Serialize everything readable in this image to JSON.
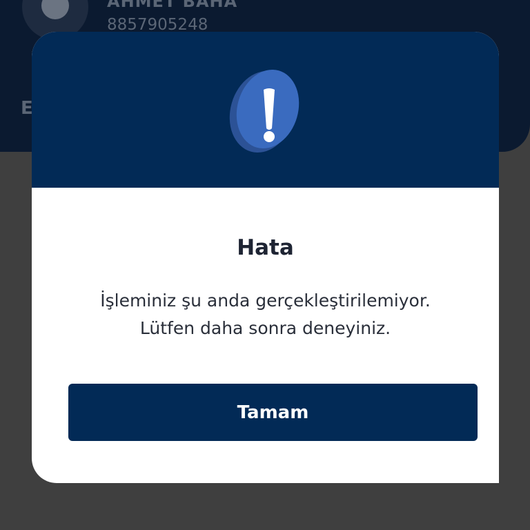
{
  "background": {
    "user_name": "AHMET BAHA",
    "phone": "8857905248",
    "section_letter": "E"
  },
  "dialog": {
    "icon": "exclamation-icon",
    "title": "Hata",
    "message_line1": "İşleminiz şu anda gerçekleştirilemiyor.",
    "message_line2": "Lütfen daha sonra deneyiniz.",
    "button_label": "Tamam"
  },
  "colors": {
    "dialog_header": "#022a56",
    "button": "#022a56",
    "icon_blue": "#3a6bbf",
    "overlay": "#3f3f3f"
  }
}
